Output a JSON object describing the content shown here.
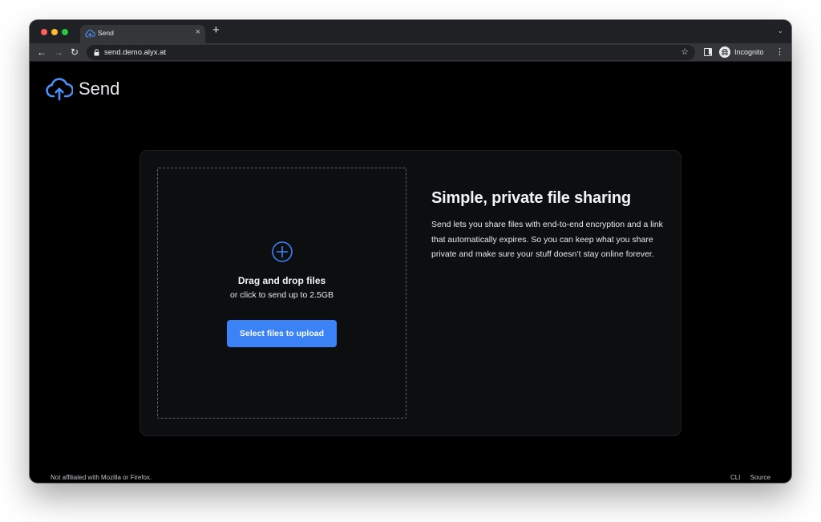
{
  "browser": {
    "tab_title": "Send",
    "new_tab": "+",
    "tab_close": "×",
    "tab_search": "⌄",
    "url": "send.demo.alyx.at",
    "profile_label": "Incognito",
    "menu": "⋮",
    "nav": {
      "back": "←",
      "forward": "→",
      "reload": "↻",
      "star": "☆"
    }
  },
  "app": {
    "brand": "Send",
    "accent_color": "#3b82f6"
  },
  "upload": {
    "title": "Drag and drop files",
    "subtitle": "or click to send up to 2.5GB",
    "button_label": "Select files to upload"
  },
  "intro": {
    "title": "Simple, private file sharing",
    "body": "Send lets you share files with end-to-end encryption and a link that automatically expires. So you can keep what you share private and make sure your stuff doesn’t stay online forever."
  },
  "footer": {
    "disclaimer": "Not affiliated with Mozilla or Firefox.",
    "links": [
      "CLI",
      "Source"
    ]
  },
  "icons": {
    "traffic_lights": [
      "close-icon",
      "minimize-icon",
      "maximize-icon"
    ],
    "logo": "cloud-upload-icon",
    "add": "plus-circle-icon",
    "lock": "lock-icon"
  }
}
